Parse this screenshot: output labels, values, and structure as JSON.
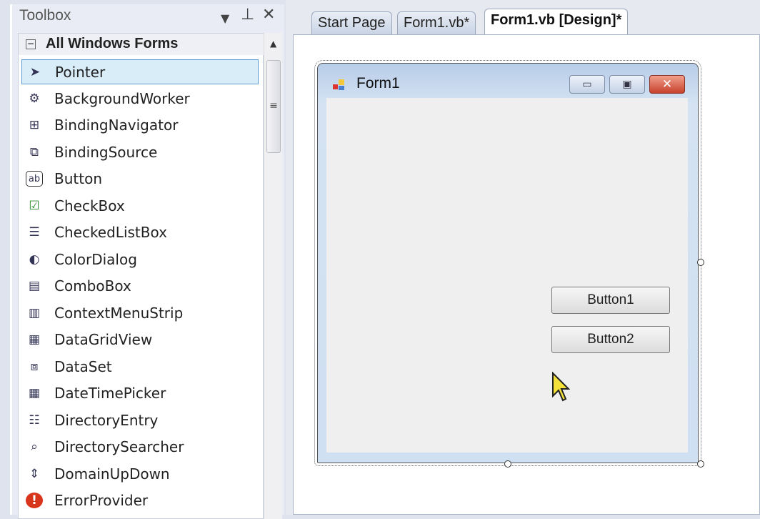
{
  "toolbox": {
    "title": "Toolbox",
    "group": "All Windows Forms",
    "items": [
      {
        "label": "Pointer",
        "icon": "pointer-icon",
        "glyph": "➤"
      },
      {
        "label": "BackgroundWorker",
        "icon": "background-worker-icon",
        "glyph": "⚙"
      },
      {
        "label": "BindingNavigator",
        "icon": "binding-navigator-icon",
        "glyph": "⊞"
      },
      {
        "label": "BindingSource",
        "icon": "binding-source-icon",
        "glyph": "⧉"
      },
      {
        "label": "Button",
        "icon": "button-icon",
        "glyph": "ab"
      },
      {
        "label": "CheckBox",
        "icon": "checkbox-icon",
        "glyph": "☑"
      },
      {
        "label": "CheckedListBox",
        "icon": "checked-list-box-icon",
        "glyph": "☰"
      },
      {
        "label": "ColorDialog",
        "icon": "color-dialog-icon",
        "glyph": "◐"
      },
      {
        "label": "ComboBox",
        "icon": "combobox-icon",
        "glyph": "▤"
      },
      {
        "label": "ContextMenuStrip",
        "icon": "context-menu-strip-icon",
        "glyph": "▥"
      },
      {
        "label": "DataGridView",
        "icon": "data-grid-view-icon",
        "glyph": "▦"
      },
      {
        "label": "DataSet",
        "icon": "dataset-icon",
        "glyph": "⧈"
      },
      {
        "label": "DateTimePicker",
        "icon": "date-time-picker-icon",
        "glyph": "▦"
      },
      {
        "label": "DirectoryEntry",
        "icon": "directory-entry-icon",
        "glyph": "☷"
      },
      {
        "label": "DirectorySearcher",
        "icon": "directory-searcher-icon",
        "glyph": "⌕"
      },
      {
        "label": "DomainUpDown",
        "icon": "domain-up-down-icon",
        "glyph": "⇕"
      },
      {
        "label": "ErrorProvider",
        "icon": "error-provider-icon",
        "glyph": "!"
      }
    ]
  },
  "tabs": [
    {
      "label": "Start Page"
    },
    {
      "label": "Form1.vb*"
    },
    {
      "label": "Form1.vb [Design]*"
    }
  ],
  "form": {
    "title": "Form1",
    "buttons": [
      "Button1",
      "Button2"
    ]
  }
}
